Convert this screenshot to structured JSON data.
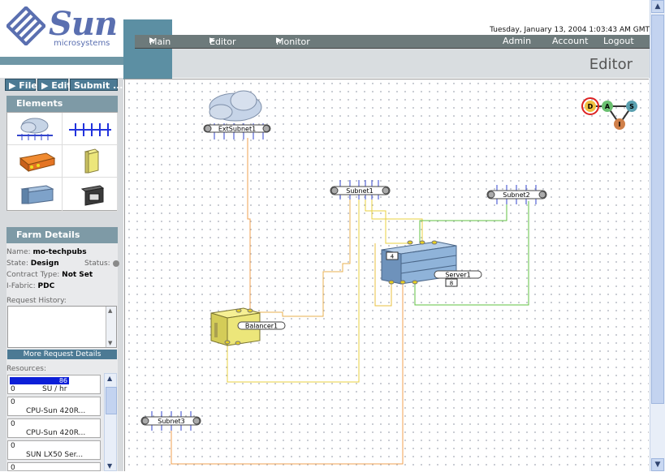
{
  "brand": {
    "name": "Sun",
    "tagline": "microsystems"
  },
  "header": {
    "datetime": "Tuesday, January 13, 2004 1:03:43 AM GMT",
    "nav": {
      "main": "Main",
      "editor": "Editor",
      "monitor": "Monitor",
      "admin": "Admin",
      "account": "Account",
      "logout": "Logout"
    },
    "page_title": "Editor"
  },
  "toolbar": {
    "file": "▶ File",
    "edit": "▶ Edit",
    "submit": "Submit ..."
  },
  "elements_panel": {
    "title": "Elements",
    "items": [
      "cloud-icon",
      "subnet-icon",
      "loadbalancer-icon",
      "server-icon",
      "server-group-icon",
      "storage-icon"
    ]
  },
  "farm_details": {
    "title": "Farm Details",
    "name_label": "Name:",
    "name": "mo-techpubs",
    "state_label": "State:",
    "state": "Design",
    "status_label": "Status:",
    "contract_label": "Contract Type:",
    "contract": "Not Set",
    "ifabric_label": "I-Fabric:",
    "ifabric": "PDC",
    "history_label": "Request History:",
    "more_button": "More Request Details",
    "resources_label": "Resources:"
  },
  "resources": [
    {
      "count": "0",
      "value": "86",
      "name": "SU / hr"
    },
    {
      "count": "0",
      "name": "CPU-Sun 420R..."
    },
    {
      "count": "0",
      "name": "CPU-Sun 420R..."
    },
    {
      "count": "0",
      "name": "SUN LX50 Ser..."
    },
    {
      "count": "0",
      "name": ""
    }
  ],
  "diagram": {
    "nodes": {
      "ext_subnet": "ExtSubnet1",
      "subnet1": "Subnet1",
      "subnet2": "Subnet2",
      "subnet3": "Subnet3",
      "server": "Server1",
      "server_top_count": "4",
      "server_bottom_count": "8",
      "balancer": "Balancer1"
    },
    "minus": "−",
    "plus": "+",
    "das_badge": {
      "d": "D",
      "a": "A",
      "s": "S",
      "i": "I"
    }
  },
  "colors": {
    "orange": "#f0a050",
    "yellow": "#e8d040",
    "green": "#60c040",
    "nav": "#6d7a7b",
    "accent": "#4c7a94"
  }
}
